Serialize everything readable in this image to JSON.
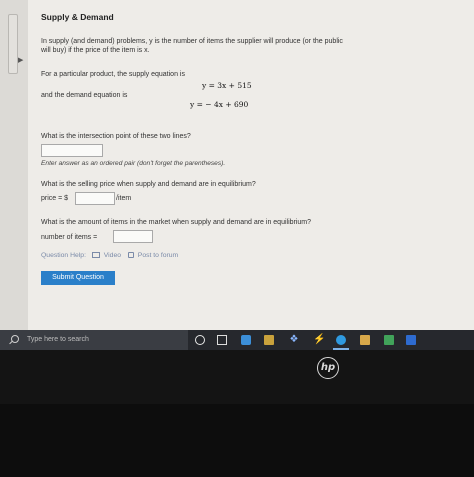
{
  "problem": {
    "title": "Supply & Demand",
    "intro_line1": "In supply (and demand) problems, y is the number of items the supplier will produce (or the public",
    "intro_line2": "will buy) if the price of the item is x.",
    "supply_intro": "For a particular product, the supply equation is",
    "supply_equation": "y = 3x + 515",
    "demand_intro": "and the demand equation is",
    "demand_equation": "y = − 4x + 690"
  },
  "questions": {
    "q1": "What is the intersection point of these two lines?",
    "q1_hint": "Enter answer as an ordered pair (don't forget the parentheses).",
    "q1_value": "",
    "q2": "What is the selling price when supply and demand are in equilibrium?",
    "q2_label": "price = $",
    "q2_value": "",
    "q2_unit": "/item",
    "q3": "What is the amount of items in the market when supply and demand are in equilibrium?",
    "q3_label": "number of items =",
    "q3_value": ""
  },
  "help": {
    "label": "Question Help:",
    "video": "Video",
    "forum": "Post to forum"
  },
  "submit_label": "Submit Question",
  "taskbar": {
    "search_placeholder": "Type here to search",
    "dropbox_glyph": "❖",
    "flash_glyph": "⚡"
  },
  "hardware": {
    "logo": "hp"
  },
  "colors": {
    "accent": "#2a7fc9",
    "taskbar": "#26282d"
  }
}
